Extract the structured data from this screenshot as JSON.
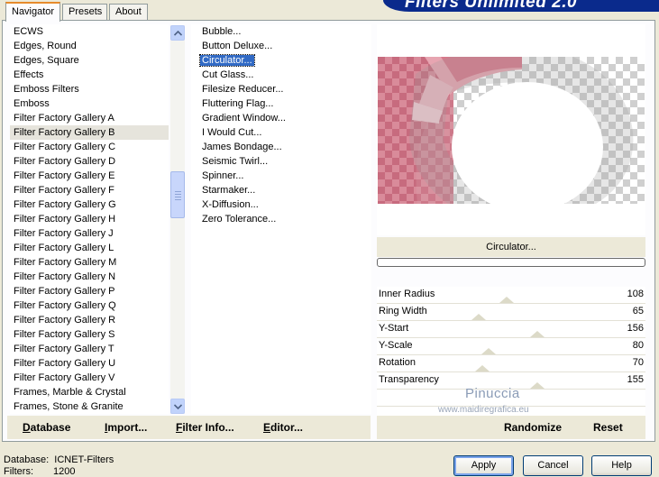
{
  "logo": {
    "text": "Filters Unlimited 2.0"
  },
  "tabs": [
    {
      "label": "Navigator",
      "active": true
    },
    {
      "label": "Presets",
      "active": false
    },
    {
      "label": "About",
      "active": false
    }
  ],
  "categories": [
    "ECWS",
    "Edges, Round",
    "Edges, Square",
    "Effects",
    "Emboss Filters",
    "Emboss",
    "Filter Factory Gallery A",
    "Filter Factory Gallery B",
    "Filter Factory Gallery C",
    "Filter Factory Gallery D",
    "Filter Factory Gallery E",
    "Filter Factory Gallery F",
    "Filter Factory Gallery G",
    "Filter Factory Gallery H",
    "Filter Factory Gallery J",
    "Filter Factory Gallery L",
    "Filter Factory Gallery M",
    "Filter Factory Gallery N",
    "Filter Factory Gallery P",
    "Filter Factory Gallery Q",
    "Filter Factory Gallery R",
    "Filter Factory Gallery S",
    "Filter Factory Gallery T",
    "Filter Factory Gallery U",
    "Filter Factory Gallery V",
    "Frames, Marble & Crystal",
    "Frames, Stone & Granite"
  ],
  "selected_category": 7,
  "filters": [
    "Bubble...",
    "Button Deluxe...",
    "Circulator...",
    "Cut Glass...",
    "Filesize Reducer...",
    "Fluttering Flag...",
    "Gradient Window...",
    "I Would Cut...",
    "James Bondage...",
    "Seismic Twirl...",
    "Spinner...",
    "Starmaker...",
    "X-Diffusion...",
    "Zero Tolerance..."
  ],
  "selected_filter": 2,
  "preview": {
    "filter_name": "Circulator..."
  },
  "sliders": [
    {
      "label": "Inner Radius",
      "value": "108",
      "level": 0.42
    },
    {
      "label": "Ring Width",
      "value": "65",
      "level": 0.25
    },
    {
      "label": "Y-Start",
      "value": "156",
      "level": 0.61
    },
    {
      "label": "Y-Scale",
      "value": "80",
      "level": 0.31
    },
    {
      "label": "Rotation",
      "value": "70",
      "level": 0.27
    },
    {
      "label": "Transparency",
      "value": "155",
      "level": 0.61
    }
  ],
  "watermark": {
    "name": "Pinuccia",
    "site": "www.maidiregrafica.eu"
  },
  "left_buttons": [
    {
      "label": "Database",
      "key": "D"
    },
    {
      "label": "Import...",
      "key": "I"
    },
    {
      "label": "Filter Info...",
      "key": "F"
    },
    {
      "label": "Editor...",
      "key": "E"
    }
  ],
  "right_buttons": {
    "randomize": "Randomize",
    "reset": "Reset"
  },
  "status": {
    "database_label": "Database:",
    "database_value": "ICNET-Filters",
    "filters_label": "Filters:",
    "filters_value": "1200"
  },
  "dialog_buttons": {
    "apply": "Apply",
    "cancel": "Cancel",
    "help": "Help"
  },
  "colors": {
    "accent": "#316ac5",
    "ring": "#d98b9a",
    "ring_dark": "#c76a7d",
    "logo_bg": "#0a2a8c"
  }
}
